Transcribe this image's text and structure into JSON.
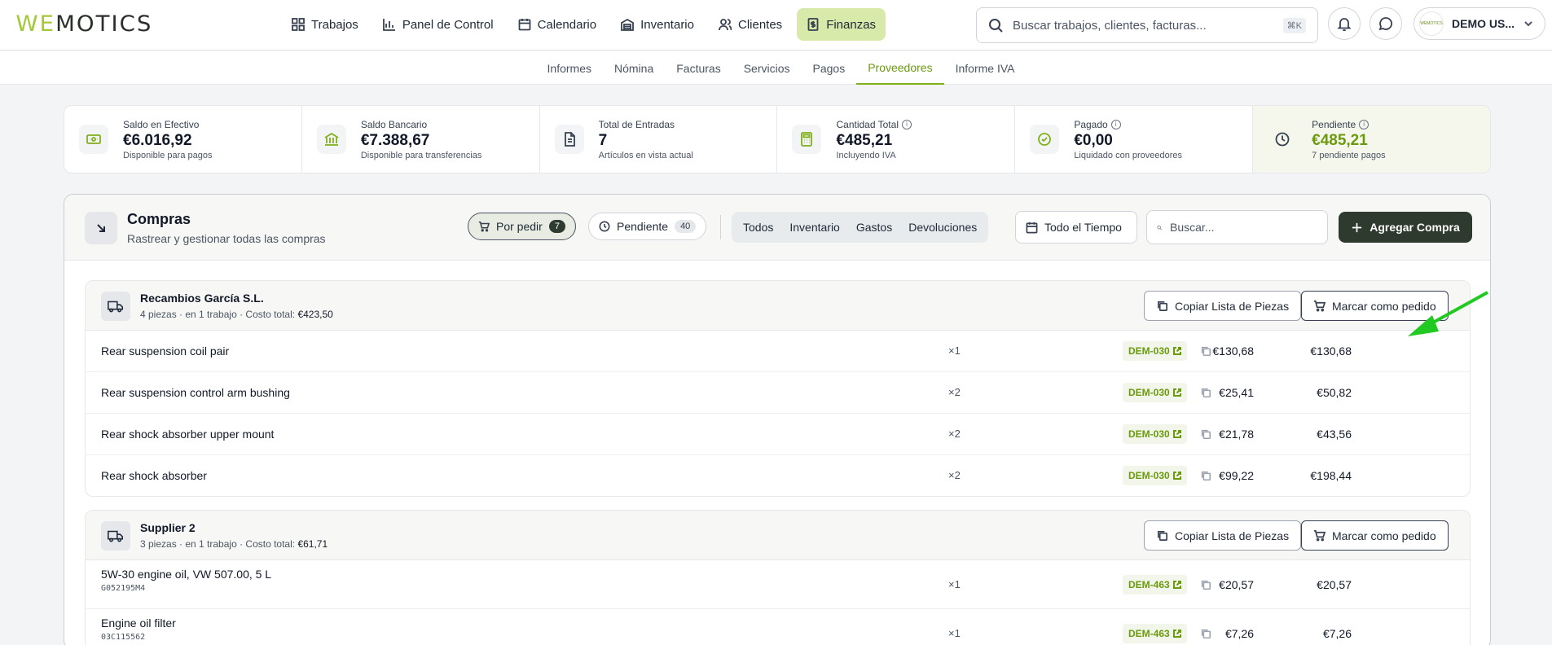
{
  "app": {
    "logo_part1": "WE",
    "logo_part2": "MOTICS"
  },
  "nav": {
    "items": [
      {
        "label": "Trabajos",
        "icon": "grid-icon"
      },
      {
        "label": "Panel de Control",
        "icon": "bar-chart-icon"
      },
      {
        "label": "Calendario",
        "icon": "calendar-icon"
      },
      {
        "label": "Inventario",
        "icon": "warehouse-icon"
      },
      {
        "label": "Clientes",
        "icon": "users-icon"
      },
      {
        "label": "Finanzas",
        "icon": "receipt-icon",
        "active": true
      }
    ]
  },
  "search": {
    "placeholder": "Buscar trabajos, clientes, facturas...",
    "shortcut": "⌘K"
  },
  "user": {
    "name": "DEMO US...",
    "avatar_text": "WEMOTICS"
  },
  "subnav": {
    "tabs": [
      "Informes",
      "Nómina",
      "Facturas",
      "Servicios",
      "Pagos",
      "Proveedores",
      "Informe IVA"
    ],
    "active": "Proveedores"
  },
  "stats": [
    {
      "label": "Saldo en Efectivo",
      "value": "€6.016,92",
      "sub": "Disponible para pagos",
      "icon": "cash-icon"
    },
    {
      "label": "Saldo Bancario",
      "value": "€7.388,67",
      "sub": "Disponible para transferencias",
      "icon": "bank-icon"
    },
    {
      "label": "Total de Entradas",
      "value": "7",
      "sub": "Artículos en vista actual",
      "icon": "document-icon"
    },
    {
      "label": "Cantidad Total",
      "value": "€485,21",
      "sub": "Incluyendo IVA",
      "icon": "calculator-icon",
      "info": true
    },
    {
      "label": "Pagado",
      "value": "€0,00",
      "sub": "Liquidado con proveedores",
      "icon": "check-circle-icon",
      "info": true
    },
    {
      "label": "Pendiente",
      "value": "€485,21",
      "sub": "7 pendiente pagos",
      "icon": "clock-icon",
      "info": true
    }
  ],
  "purchases": {
    "title": "Compras",
    "subtitle": "Rastrear y gestionar todas las compras",
    "filter_to_order": {
      "label": "Por pedir",
      "count": "7"
    },
    "filter_pending": {
      "label": "Pendiente",
      "count": "40"
    },
    "segments": [
      "Todos",
      "Inventario",
      "Gastos",
      "Devoluciones"
    ],
    "date_label": "Todo el Tiempo",
    "search_placeholder": "Buscar...",
    "add_label": "Agregar Compra"
  },
  "suppliers": [
    {
      "name": "Recambios García S.L.",
      "meta_prefix": "4 piezas · en 1 trabajo · Costo total: ",
      "meta_total": "€423,50",
      "copy_label": "Copiar Lista de Piezas",
      "mark_label": "Marcar como pedido",
      "items": [
        {
          "name": "Rear suspension coil pair",
          "code": "",
          "qty": "×1",
          "unit": "€130,68",
          "total": "€130,68",
          "job": "DEM-030"
        },
        {
          "name": "Rear suspension control arm bushing",
          "code": "",
          "qty": "×2",
          "unit": "€25,41",
          "total": "€50,82",
          "job": "DEM-030"
        },
        {
          "name": "Rear shock absorber upper mount",
          "code": "",
          "qty": "×2",
          "unit": "€21,78",
          "total": "€43,56",
          "job": "DEM-030"
        },
        {
          "name": "Rear shock absorber",
          "code": "",
          "qty": "×2",
          "unit": "€99,22",
          "total": "€198,44",
          "job": "DEM-030"
        }
      ]
    },
    {
      "name": "Supplier 2",
      "meta_prefix": "3 piezas · en 1 trabajo · Costo total: ",
      "meta_total": "€61,71",
      "copy_label": "Copiar Lista de Piezas",
      "mark_label": "Marcar como pedido",
      "items": [
        {
          "name": "5W-30 engine oil, VW 507.00, 5 L",
          "code": "G052195M4",
          "qty": "×1",
          "unit": "€20,57",
          "total": "€20,57",
          "job": "DEM-463"
        },
        {
          "name": "Engine oil filter",
          "code": "03C115562",
          "qty": "×1",
          "unit": "€7,26",
          "total": "€7,26",
          "job": "DEM-463"
        }
      ]
    }
  ],
  "colors": {
    "accent": "#7fb01b",
    "dark_button": "#2d3a2d",
    "arrow": "#22c922"
  }
}
